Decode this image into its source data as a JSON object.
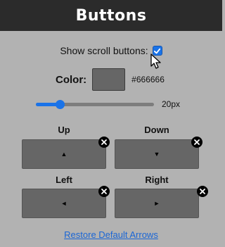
{
  "header": {
    "title": "Buttons"
  },
  "scroll_buttons": {
    "label": "Show scroll buttons:",
    "checked": true
  },
  "color": {
    "label": "Color:",
    "value": "#666666",
    "swatch": "#666666"
  },
  "size_slider": {
    "value_label": "20px",
    "level_fraction": 0.2
  },
  "arrows": {
    "up": {
      "label": "Up",
      "glyph": "▲"
    },
    "down": {
      "label": "Down",
      "glyph": "▼"
    },
    "left": {
      "label": "Left",
      "glyph": "◄"
    },
    "right": {
      "label": "Right",
      "glyph": "►"
    }
  },
  "restore_link": {
    "label": "Restore Default Arrows"
  },
  "icons": {
    "checkbox": "check-icon",
    "remove": "close-icon",
    "cursor": "mouse-pointer-icon"
  },
  "colors": {
    "header_bg": "#2b2b2b",
    "page_bg": "#b2b2b2",
    "accent": "#1a73e8",
    "button_bg": "#666666",
    "link": "#1a66d6"
  }
}
